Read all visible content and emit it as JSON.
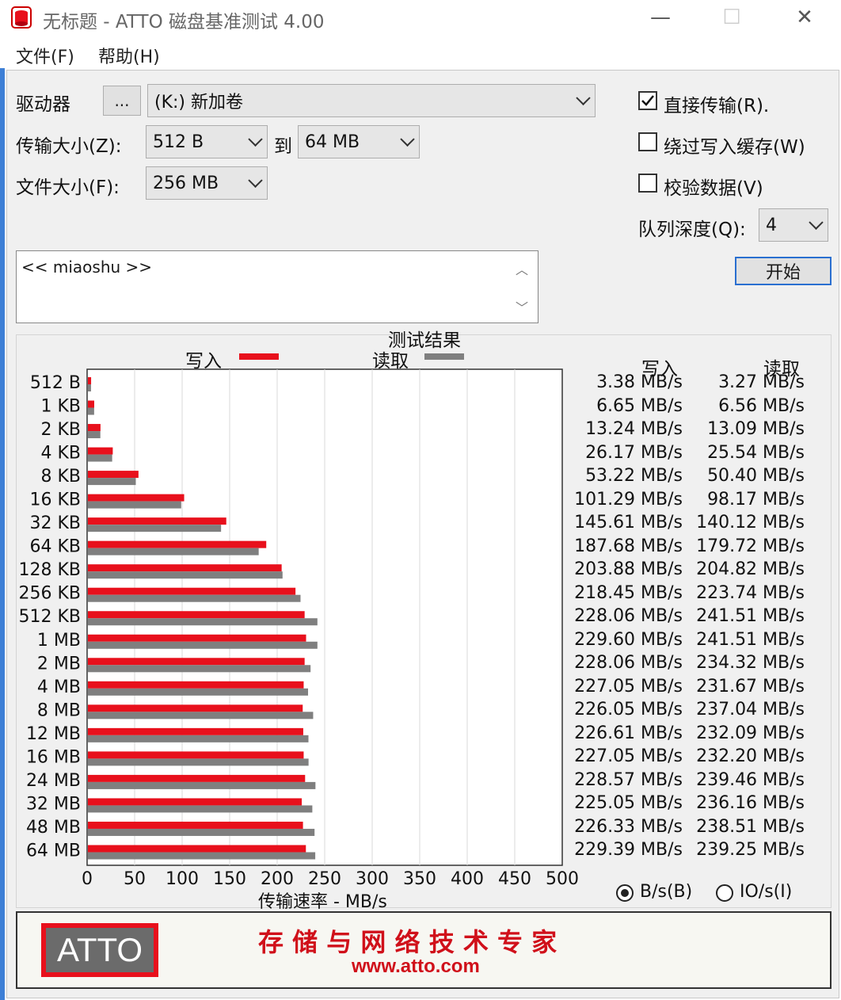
{
  "window": {
    "title": "无标题 - ATTO 磁盘基准测试 4.00",
    "minimize": "—",
    "maximize": "☐",
    "close": "✕"
  },
  "menu": {
    "file": "文件(F)",
    "help": "帮助(H)"
  },
  "settings": {
    "drive_label": "驱动器",
    "browse_label": "...",
    "drive_value": "(K:) 新加卷",
    "transfer_label": "传输大小(Z):",
    "transfer_from": "512 B",
    "to_label": "到",
    "transfer_to": "64 MB",
    "file_size_label": "文件大小(F):",
    "file_size": "256 MB",
    "direct_io_label": "直接传输(R).",
    "direct_io_checked": true,
    "bypass_cache_label": "绕过写入缓存(W)",
    "bypass_cache_checked": false,
    "verify_label": "校验数据(V)",
    "verify_checked": false,
    "queue_label": "队列深度(Q):",
    "queue_value": "4",
    "start_label": "开始",
    "description": "<< miaoshu >>"
  },
  "results": {
    "title": "测试结果",
    "write_col": "写入",
    "read_col": "读取",
    "units_bs": "B/s(B)",
    "units_io": "IO/s(I)",
    "units_selected": "bs"
  },
  "chart_data": {
    "type": "bar",
    "orientation": "horizontal",
    "title": "测试结果",
    "xlabel": "传输速率 - MB/s",
    "xlim": [
      0,
      500
    ],
    "x_ticks": [
      "0",
      "50",
      "100",
      "150",
      "200",
      "250",
      "300",
      "350",
      "400",
      "450",
      "500"
    ],
    "grid": true,
    "categories": [
      "512 B",
      "1 KB",
      "2 KB",
      "4 KB",
      "8 KB",
      "16 KB",
      "32 KB",
      "64 KB",
      "128 KB",
      "256 KB",
      "512 KB",
      "1 MB",
      "2 MB",
      "4 MB",
      "8 MB",
      "12 MB",
      "16 MB",
      "24 MB",
      "32 MB",
      "48 MB",
      "64 MB"
    ],
    "series": [
      {
        "name": "写入",
        "color": "#e8101c",
        "values": [
          3.38,
          6.65,
          13.24,
          26.17,
          53.22,
          101.29,
          145.61,
          187.68,
          203.88,
          218.45,
          228.06,
          229.6,
          228.06,
          227.05,
          226.05,
          226.61,
          227.05,
          228.57,
          225.05,
          226.33,
          229.39
        ],
        "labels": [
          "3.38 MB/s",
          "6.65 MB/s",
          "13.24 MB/s",
          "26.17 MB/s",
          "53.22 MB/s",
          "101.29 MB/s",
          "145.61 MB/s",
          "187.68 MB/s",
          "203.88 MB/s",
          "218.45 MB/s",
          "228.06 MB/s",
          "229.60 MB/s",
          "228.06 MB/s",
          "227.05 MB/s",
          "226.05 MB/s",
          "226.61 MB/s",
          "227.05 MB/s",
          "228.57 MB/s",
          "225.05 MB/s",
          "226.33 MB/s",
          "229.39 MB/s"
        ]
      },
      {
        "name": "读取",
        "color": "#7f7f7f",
        "values": [
          3.27,
          6.56,
          13.09,
          25.54,
          50.4,
          98.17,
          140.12,
          179.72,
          204.82,
          223.74,
          241.51,
          241.51,
          234.32,
          231.67,
          237.04,
          232.09,
          232.2,
          239.46,
          236.16,
          238.51,
          239.25
        ],
        "labels": [
          "3.27 MB/s",
          "6.56 MB/s",
          "13.09 MB/s",
          "25.54 MB/s",
          "50.40 MB/s",
          "98.17 MB/s",
          "140.12 MB/s",
          "179.72 MB/s",
          "204.82 MB/s",
          "223.74 MB/s",
          "241.51 MB/s",
          "241.51 MB/s",
          "234.32 MB/s",
          "231.67 MB/s",
          "237.04 MB/s",
          "232.09 MB/s",
          "232.20 MB/s",
          "239.46 MB/s",
          "236.16 MB/s",
          "238.51 MB/s",
          "239.25 MB/s"
        ]
      }
    ],
    "legend": "top"
  },
  "footer": {
    "logo": "ATTO",
    "slogan": "存 储 与 网 络 技 术 专 家",
    "url": "www.atto.com"
  }
}
